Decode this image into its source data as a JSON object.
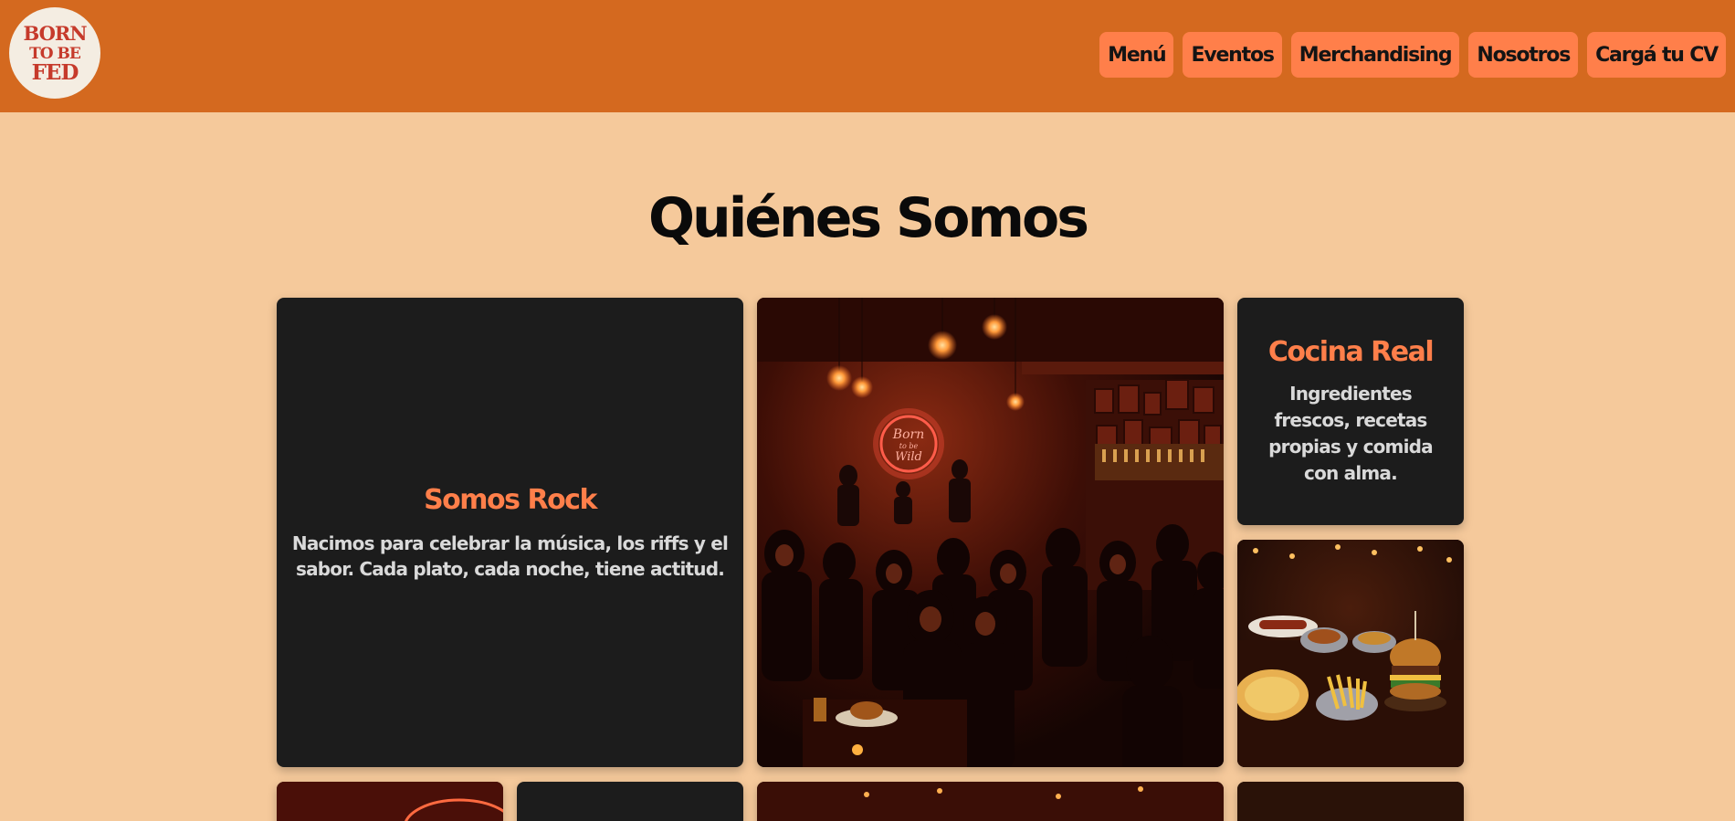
{
  "header": {
    "logo_text": [
      "BORN",
      "TO BE",
      "FED"
    ],
    "nav": [
      {
        "label": "Menú"
      },
      {
        "label": "Eventos"
      },
      {
        "label": "Merchandising"
      },
      {
        "label": "Nosotros"
      },
      {
        "label": "Cargá tu CV"
      }
    ]
  },
  "main": {
    "title": "Quiénes Somos",
    "cards": {
      "rock": {
        "heading": "Somos Rock",
        "body": "Nacimos para celebrar la música, los riffs y el sabor. Cada plato, cada noche, tiene actitud."
      },
      "cocina": {
        "heading": "Cocina Real",
        "body": "Ingredientes frescos, recetas propias y comida con alma."
      }
    },
    "bar_photo_sign": [
      "Born",
      "to be",
      "Wild"
    ]
  },
  "colors": {
    "header_bg": "#d4691f",
    "page_bg": "#f5c99b",
    "nav_button_bg": "#ff7f4a",
    "card_bg": "#1c1c1c",
    "accent": "#ff7f4a",
    "logo_red": "#c63a2b"
  }
}
